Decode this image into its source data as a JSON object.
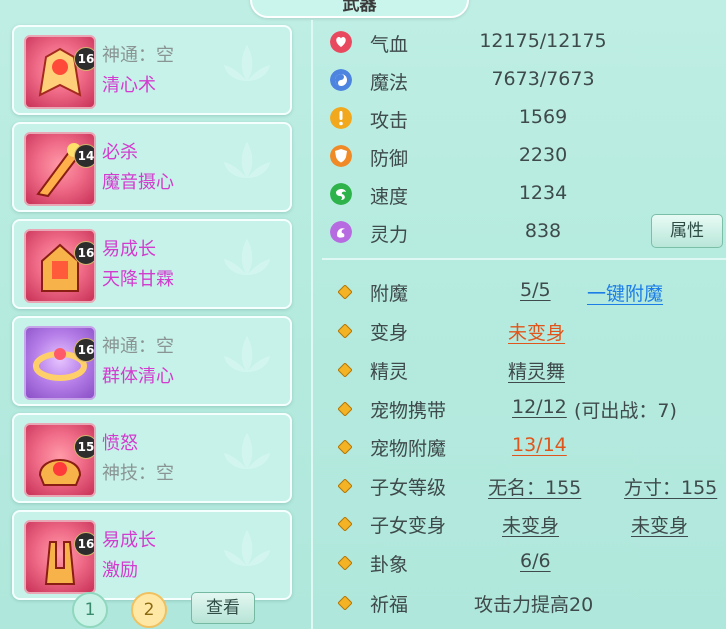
{
  "header": {
    "title": "武器"
  },
  "slots": [
    {
      "level": "16",
      "line1": "神通：空",
      "line2": "清心术"
    },
    {
      "level": "14",
      "line1": "必杀",
      "line2": "魔音摄心"
    },
    {
      "level": "16",
      "line1": "易成长",
      "line2": "天降甘霖"
    },
    {
      "level": "16",
      "line1": "神通：空",
      "line2": "群体清心"
    },
    {
      "level": "15",
      "line1": "愤怒",
      "line2": "神技：空"
    },
    {
      "level": "16",
      "line1": "易成长",
      "line2": "激励"
    }
  ],
  "pager": {
    "page1": "1",
    "page2": "2",
    "view_label": "查看"
  },
  "stats": [
    {
      "label": "气血",
      "value": "12175/12175",
      "icon": "heart-icon",
      "color": "#e9495e"
    },
    {
      "label": "魔法",
      "value": "7673/7673",
      "icon": "yin-yang-icon",
      "color": "#4c84e0"
    },
    {
      "label": "攻击",
      "value": "1569",
      "icon": "exclamation-icon",
      "color": "#f2a81d"
    },
    {
      "label": "防御",
      "value": "2230",
      "icon": "shield-icon",
      "color": "#f08a26"
    },
    {
      "label": "速度",
      "value": "1234",
      "icon": "swirl-icon",
      "color": "#2eb34b"
    },
    {
      "label": "灵力",
      "value": "838",
      "icon": "spirit-icon",
      "color": "#b66be0"
    }
  ],
  "attr_button": "属性",
  "info": {
    "enchant": {
      "label": "附魔",
      "value": "5/5",
      "link": "一键附魔"
    },
    "transform": {
      "label": "变身",
      "value": "未变身"
    },
    "sprite": {
      "label": "精灵",
      "value": "精灵舞"
    },
    "pet_carry": {
      "label": "宠物携带",
      "value": "12/12",
      "note": "(可出战：7)"
    },
    "pet_enchant": {
      "label": "宠物附魔",
      "value": "13/14"
    },
    "child_level": {
      "label": "子女等级",
      "value1": "无名：155",
      "value2": "方寸：155"
    },
    "child_transform": {
      "label": "子女变身",
      "value1": "未变身",
      "value2": "未变身"
    },
    "hexagram": {
      "label": "卦象",
      "value": "6/6"
    },
    "blessing": {
      "label": "祈福",
      "value": "攻击力提高20"
    }
  }
}
